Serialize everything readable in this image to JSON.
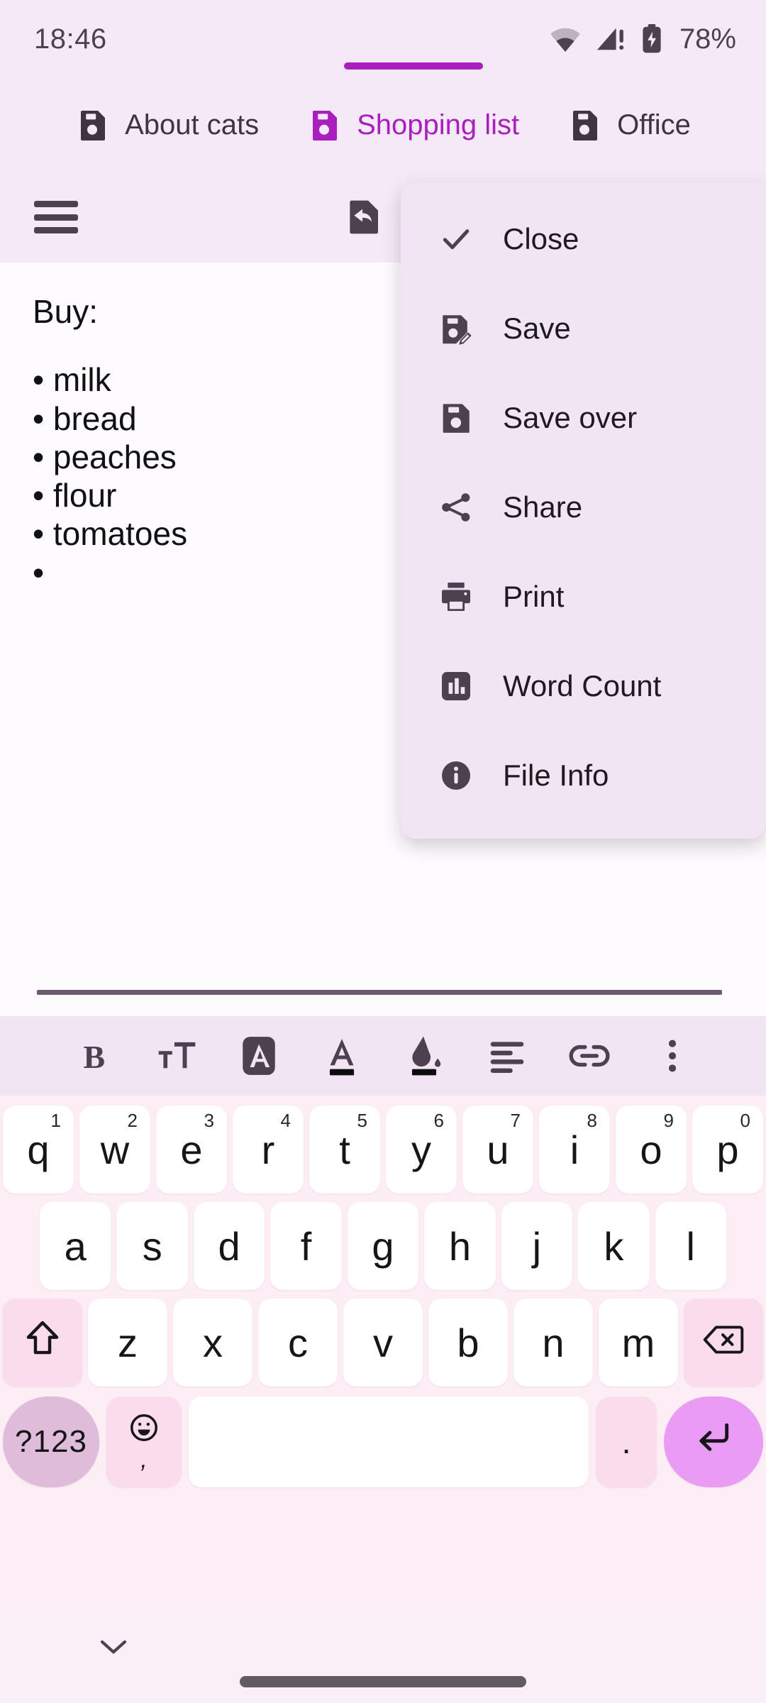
{
  "status_bar": {
    "clock": "18:46",
    "battery_percent": "78%",
    "icons": [
      "wifi-icon",
      "cellular-signal-warning-icon",
      "battery-charging-icon"
    ]
  },
  "tabs": [
    {
      "label": "About cats",
      "icon": "floppy-disk-icon",
      "active": false
    },
    {
      "label": "Shopping list",
      "icon": "floppy-disk-icon",
      "active": true
    },
    {
      "label": "Office",
      "icon": "floppy-disk-icon",
      "active": false
    }
  ],
  "action_bar": {
    "menu_icon": "hamburger-menu-icon",
    "revert_icon": "revert-document-icon"
  },
  "document": {
    "lines": [
      "Buy:",
      "",
      "• milk",
      "• bread",
      "• peaches",
      "• flour",
      "• tomatoes",
      "• "
    ]
  },
  "overflow_menu": {
    "items": [
      {
        "label": "Close",
        "icon": "checkmark-icon"
      },
      {
        "label": "Save",
        "icon": "save-as-icon"
      },
      {
        "label": "Save over",
        "icon": "floppy-disk-icon"
      },
      {
        "label": "Share",
        "icon": "share-icon"
      },
      {
        "label": "Print",
        "icon": "printer-icon"
      },
      {
        "label": "Word Count",
        "icon": "bar-chart-icon"
      },
      {
        "label": "File Info",
        "icon": "info-icon"
      }
    ]
  },
  "format_toolbar": {
    "buttons": [
      {
        "label": "B",
        "name": "bold-icon",
        "active": false
      },
      {
        "label": "",
        "name": "text-size-icon",
        "active": false
      },
      {
        "label": "A",
        "name": "typeface-icon",
        "active": true
      },
      {
        "label": "A",
        "name": "text-color-icon",
        "active": false
      },
      {
        "label": "",
        "name": "fill-color-icon",
        "active": false
      },
      {
        "label": "",
        "name": "align-left-icon",
        "active": false
      },
      {
        "label": "",
        "name": "link-icon",
        "active": false
      },
      {
        "label": "",
        "name": "more-options-icon",
        "active": false
      }
    ]
  },
  "keyboard": {
    "row1": [
      {
        "key": "q",
        "hint": "1"
      },
      {
        "key": "w",
        "hint": "2"
      },
      {
        "key": "e",
        "hint": "3"
      },
      {
        "key": "r",
        "hint": "4"
      },
      {
        "key": "t",
        "hint": "5"
      },
      {
        "key": "y",
        "hint": "6"
      },
      {
        "key": "u",
        "hint": "7"
      },
      {
        "key": "i",
        "hint": "8"
      },
      {
        "key": "o",
        "hint": "9"
      },
      {
        "key": "p",
        "hint": "0"
      }
    ],
    "row2": [
      {
        "key": "a"
      },
      {
        "key": "s"
      },
      {
        "key": "d"
      },
      {
        "key": "f"
      },
      {
        "key": "g"
      },
      {
        "key": "h"
      },
      {
        "key": "j"
      },
      {
        "key": "k"
      },
      {
        "key": "l"
      }
    ],
    "row3": [
      {
        "key": "z"
      },
      {
        "key": "x"
      },
      {
        "key": "c"
      },
      {
        "key": "v"
      },
      {
        "key": "b"
      },
      {
        "key": "n"
      },
      {
        "key": "m"
      }
    ],
    "shift_icon": "shift-up-arrow-icon",
    "backspace_icon": "backspace-icon",
    "numeric_label": "?123",
    "emoji_icon": "emoji-smiley-icon",
    "emoji_secondary": ",",
    "space_label": "",
    "period_label": ".",
    "enter_icon": "enter-return-icon"
  },
  "nav_bar": {
    "hide_keyboard_icon": "chevron-down-icon",
    "home_indicator": "home-indicator"
  },
  "colors": {
    "accent_purple": "#a81fbe",
    "surface": "#f4e9f6",
    "menu_surface": "#f1e5f4",
    "document_bg": "#fdfbfd",
    "icon_dark": "#4c414f",
    "keyboard_bg": "#fdeef6",
    "key_white": "#ffffff",
    "key_mod_pink": "#fadcec",
    "key_num_pink": "#dfbcd9",
    "key_enter_purple": "#ea9cf5"
  }
}
